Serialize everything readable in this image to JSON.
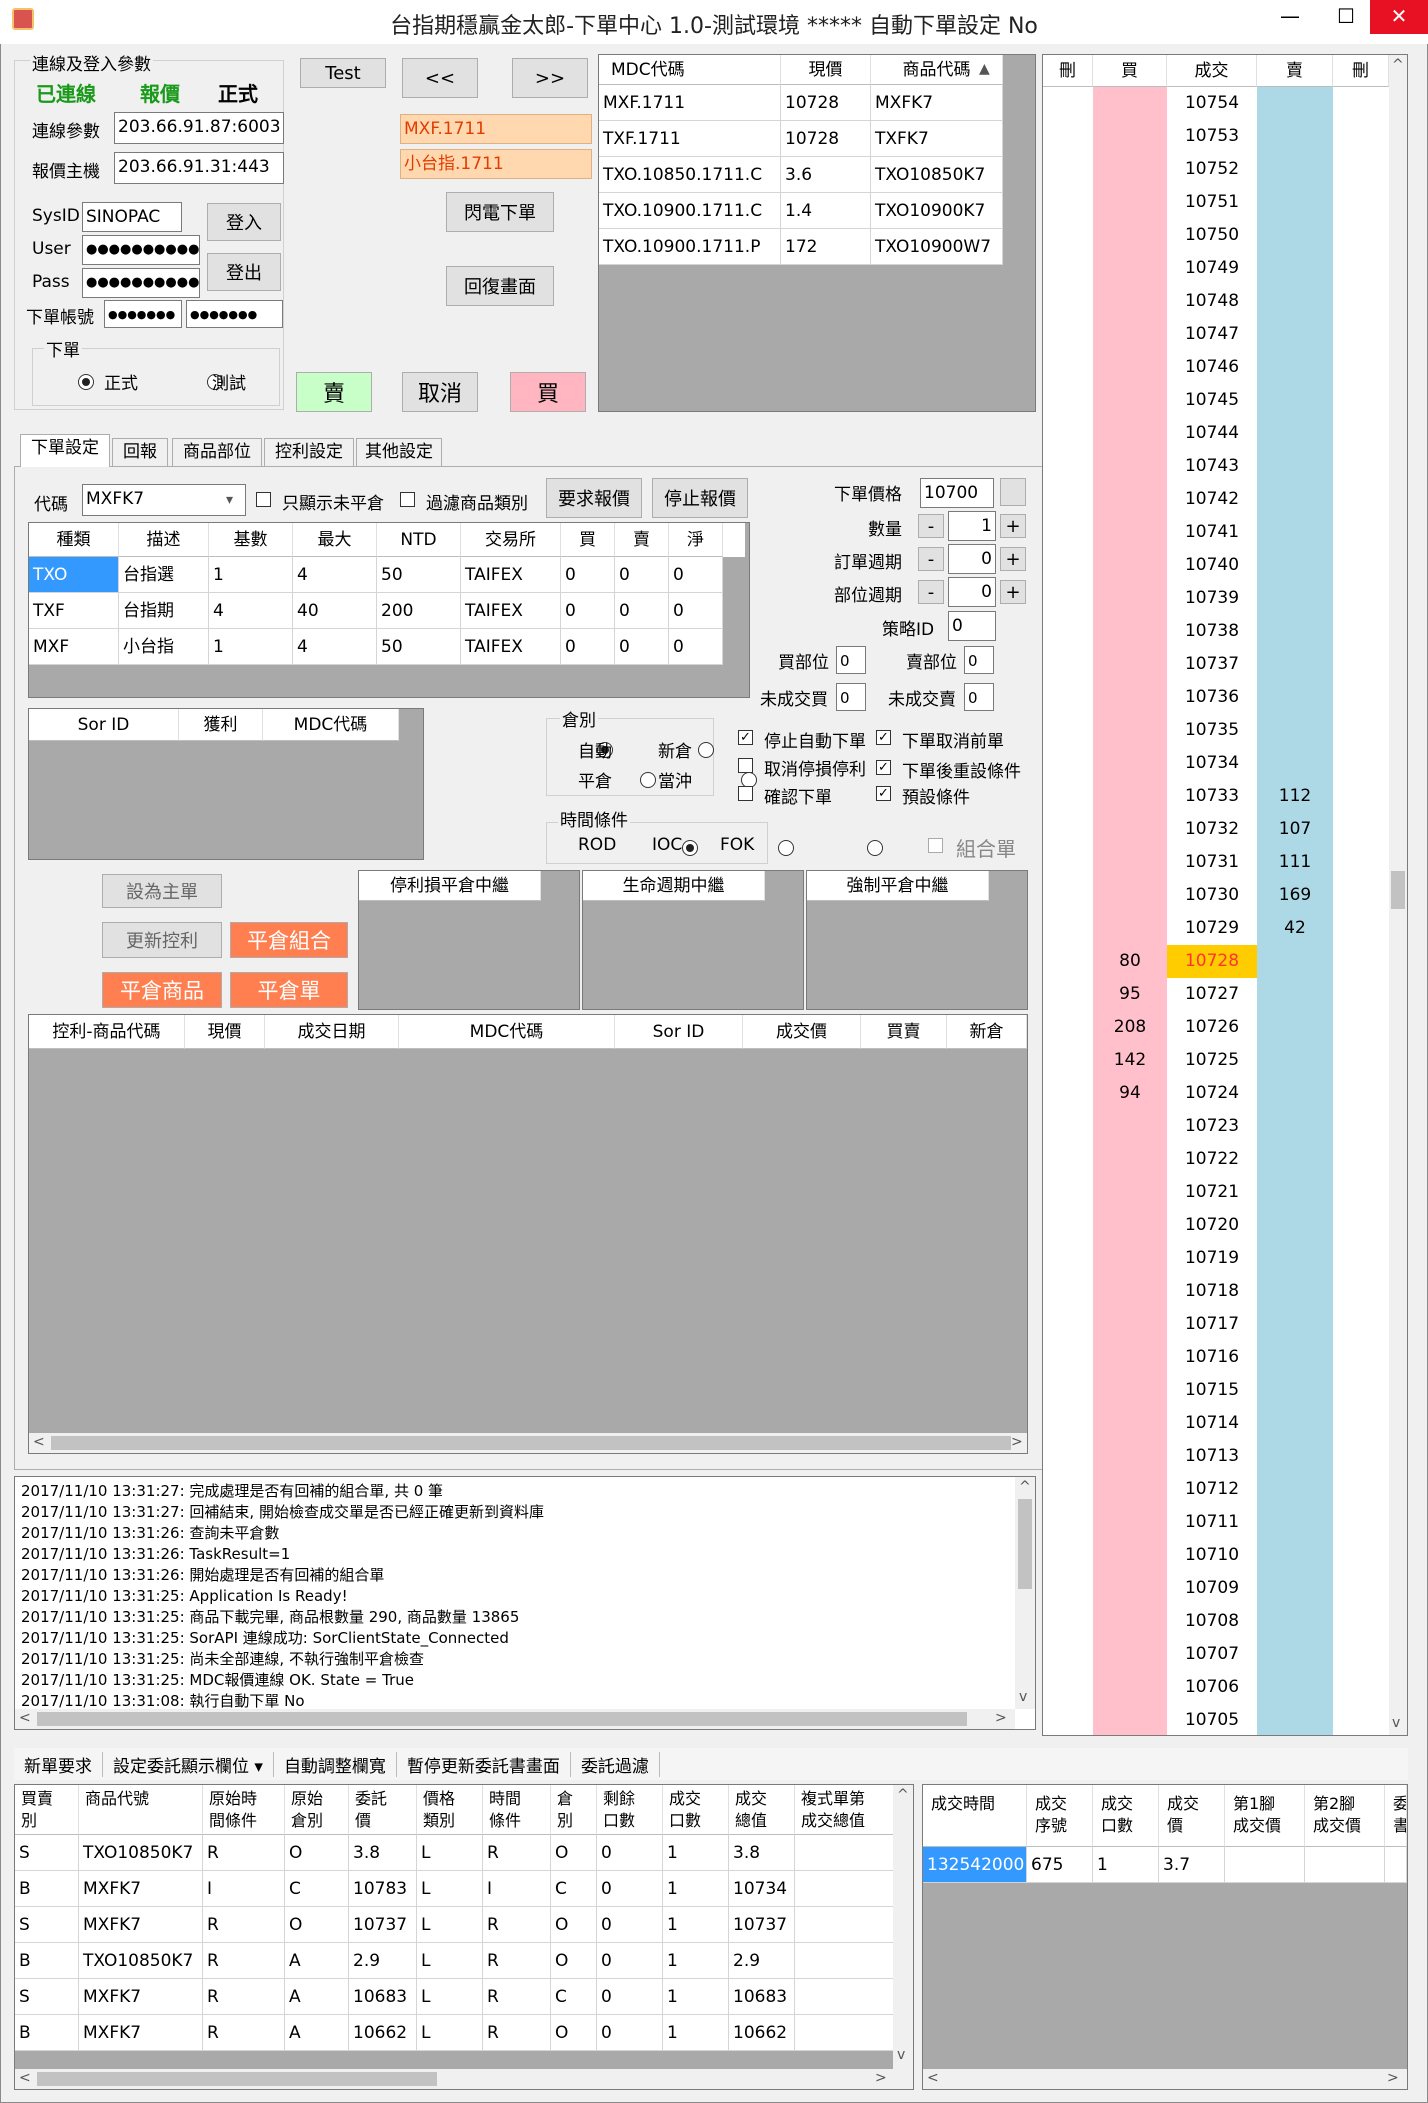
{
  "window": {
    "title": "台指期穩贏金太郎-下單中心 1.0-測試環境 ***** 自動下單設定 No",
    "minimize": "—",
    "maximize": "☐",
    "close": "✕"
  },
  "login": {
    "group": "連線及登入參數",
    "status_connected": "已連線",
    "status_quote": "報價",
    "status_mode": "正式",
    "conn_label": "連線參數",
    "conn_value": "203.66.91.87:6003",
    "quote_label": "報價主機",
    "quote_value": "203.66.91.31:443",
    "sysid_label": "SysID",
    "sysid_value": "SINOPAC",
    "user_label": "User",
    "user_value": "●●●●●●●●●●●",
    "pass_label": "Pass",
    "pass_value": "●●●●●●●●●●●",
    "account_label": "下單帳號",
    "account_value1": "●●●●●●●",
    "account_value2": "●●●●●●●",
    "login_btn": "登入",
    "logout_btn": "登出",
    "order_group": "下單",
    "radio_real": "正式",
    "radio_test": "測試"
  },
  "center": {
    "test_btn": "Test",
    "prev_btn": "<<",
    "next_btn": ">>",
    "sym1": "MXF.1711",
    "sym2": "小台指.1711",
    "flash_btn": "閃電下單",
    "restore_btn": "回復畫面",
    "sell_btn": "賣",
    "cancel_btn": "取消",
    "buy_btn": "買"
  },
  "mdc": {
    "headers": [
      "MDC代碼",
      "現價",
      "商品代碼"
    ],
    "rows": [
      [
        "MXF.1711",
        "10728",
        "MXFK7"
      ],
      [
        "TXF.1711",
        "10728",
        "TXFK7"
      ],
      [
        "TXO.10850.1711.C",
        "3.6",
        "TXO10850K7"
      ],
      [
        "TXO.10900.1711.C",
        "1.4",
        "TXO10900K7"
      ],
      [
        "TXO.10900.1711.P",
        "172",
        "TXO10900W7"
      ]
    ]
  },
  "tabs": [
    "下單設定",
    "回報",
    "商品部位",
    "控利設定",
    "其他設定"
  ],
  "order": {
    "code_label": "代碼",
    "code_value": "MXFK7",
    "only_open_label": "只顯示未平倉",
    "filter_label": "過濾商品類別",
    "req_quote_btn": "要求報價",
    "stop_quote_btn": "停止報價",
    "price_label": "下單價格",
    "price_value": "10700",
    "qty_label": "數量",
    "qty_value": "1",
    "order_cycle_label": "訂單週期",
    "order_cycle_value": "0",
    "pos_cycle_label": "部位週期",
    "pos_cycle_value": "0",
    "strategy_label": "策略ID",
    "strategy_value": "0",
    "buy_pos_label": "買部位",
    "buy_pos_value": "0",
    "sell_pos_label": "賣部位",
    "sell_pos_value": "0",
    "unfilled_buy_label": "未成交買",
    "unfilled_buy_value": "0",
    "unfilled_sell_label": "未成交賣",
    "unfilled_sell_value": "0",
    "minus": "-",
    "plus": "+"
  },
  "products": {
    "headers": [
      "種類",
      "描述",
      "基數",
      "最大",
      "NTD",
      "交易所",
      "買",
      "賣",
      "淨"
    ],
    "rows": [
      [
        "TXO",
        "台指選",
        "1",
        "4",
        "50",
        "TAIFEX",
        "0",
        "0",
        "0"
      ],
      [
        "TXF",
        "台指期",
        "4",
        "40",
        "200",
        "TAIFEX",
        "0",
        "0",
        "0"
      ],
      [
        "MXF",
        "小台指",
        "1",
        "4",
        "50",
        "TAIFEX",
        "0",
        "0",
        "0"
      ]
    ]
  },
  "sor": {
    "headers": [
      "Sor ID",
      "獲利",
      "MDC代碼"
    ]
  },
  "position": {
    "group": "倉別",
    "auto": "自動",
    "new": "新倉",
    "close": "平倉",
    "daytrade": "當沖",
    "time_group": "時間條件",
    "rod": "ROD",
    "ioc": "IOC",
    "fok": "FOK"
  },
  "checks": {
    "stop_auto": "停止自動下單",
    "cancel_before": "下單取消前單",
    "cancel_stop": "取消停損停利",
    "reset_after": "下單後重設條件",
    "confirm": "確認下單",
    "preset": "預設條件",
    "combo": "組合單"
  },
  "actions": {
    "set_main": "設為主單",
    "update_ctrl": "更新控利",
    "close_combo": "平倉組合",
    "close_product": "平倉商品",
    "close_order": "平倉單",
    "relay1": "停利損平倉中繼",
    "relay2": "生命週期中繼",
    "relay3": "強制平倉中繼"
  },
  "ctrl_grid": {
    "headers": [
      "控利-商品代碼",
      "現價",
      "成交日期",
      "MDC代碼",
      "Sor ID",
      "成交價",
      "買賣",
      "新倉"
    ]
  },
  "log": [
    "2017/11/10 13:31:27: 完成處理是否有回補的組合單, 共 0 筆",
    "2017/11/10 13:31:27: 回補結束, 開始檢查成交單是否已經正確更新到資料庫",
    "2017/11/10 13:31:26: 查詢未平倉數",
    "2017/11/10 13:31:26: TaskResult=1",
    "2017/11/10 13:31:26: 開始處理是否有回補的組合單",
    "2017/11/10 13:31:25: Application Is Ready!",
    "2017/11/10 13:31:25: 商品下載完畢, 商品根數量 290, 商品數量 13865",
    "2017/11/10 13:31:25: SorAPI 連線成功: SorClientState_Connected",
    "2017/11/10 13:31:25: 尚未全部連線, 不執行強制平倉檢查",
    "2017/11/10 13:31:25: MDC報價連線 OK. State = True",
    "2017/11/10 13:31:08: 執行自動下單 No"
  ],
  "ladder": {
    "headers": [
      "刪",
      "買",
      "成交",
      "賣",
      "刪"
    ],
    "rows": [
      [
        "",
        "",
        "10754",
        "",
        ""
      ],
      [
        "",
        "",
        "10753",
        "",
        ""
      ],
      [
        "",
        "",
        "10752",
        "",
        ""
      ],
      [
        "",
        "",
        "10751",
        "",
        ""
      ],
      [
        "",
        "",
        "10750",
        "",
        ""
      ],
      [
        "",
        "",
        "10749",
        "",
        ""
      ],
      [
        "",
        "",
        "10748",
        "",
        ""
      ],
      [
        "",
        "",
        "10747",
        "",
        ""
      ],
      [
        "",
        "",
        "10746",
        "",
        ""
      ],
      [
        "",
        "",
        "10745",
        "",
        ""
      ],
      [
        "",
        "",
        "10744",
        "",
        ""
      ],
      [
        "",
        "",
        "10743",
        "",
        ""
      ],
      [
        "",
        "",
        "10742",
        "",
        ""
      ],
      [
        "",
        "",
        "10741",
        "",
        ""
      ],
      [
        "",
        "",
        "10740",
        "",
        ""
      ],
      [
        "",
        "",
        "10739",
        "",
        ""
      ],
      [
        "",
        "",
        "10738",
        "",
        ""
      ],
      [
        "",
        "",
        "10737",
        "",
        ""
      ],
      [
        "",
        "",
        "10736",
        "",
        ""
      ],
      [
        "",
        "",
        "10735",
        "",
        ""
      ],
      [
        "",
        "",
        "10734",
        "",
        ""
      ],
      [
        "",
        "",
        "10733",
        "112",
        ""
      ],
      [
        "",
        "",
        "10732",
        "107",
        ""
      ],
      [
        "",
        "",
        "10731",
        "111",
        ""
      ],
      [
        "",
        "",
        "10730",
        "169",
        ""
      ],
      [
        "",
        "",
        "10729",
        "42",
        ""
      ],
      [
        "",
        "80",
        "10728",
        "",
        ""
      ],
      [
        "",
        "95",
        "10727",
        "",
        ""
      ],
      [
        "",
        "208",
        "10726",
        "",
        ""
      ],
      [
        "",
        "142",
        "10725",
        "",
        ""
      ],
      [
        "",
        "94",
        "10724",
        "",
        ""
      ],
      [
        "",
        "",
        "10723",
        "",
        ""
      ],
      [
        "",
        "",
        "10722",
        "",
        ""
      ],
      [
        "",
        "",
        "10721",
        "",
        ""
      ],
      [
        "",
        "",
        "10720",
        "",
        ""
      ],
      [
        "",
        "",
        "10719",
        "",
        ""
      ],
      [
        "",
        "",
        "10718",
        "",
        ""
      ],
      [
        "",
        "",
        "10717",
        "",
        ""
      ],
      [
        "",
        "",
        "10716",
        "",
        ""
      ],
      [
        "",
        "",
        "10715",
        "",
        ""
      ],
      [
        "",
        "",
        "10714",
        "",
        ""
      ],
      [
        "",
        "",
        "10713",
        "",
        ""
      ],
      [
        "",
        "",
        "10712",
        "",
        ""
      ],
      [
        "",
        "",
        "10711",
        "",
        ""
      ],
      [
        "",
        "",
        "10710",
        "",
        ""
      ],
      [
        "",
        "",
        "10709",
        "",
        ""
      ],
      [
        "",
        "",
        "10708",
        "",
        ""
      ],
      [
        "",
        "",
        "10707",
        "",
        ""
      ],
      [
        "",
        "",
        "10706",
        "",
        ""
      ],
      [
        "",
        "",
        "10705",
        "",
        ""
      ]
    ],
    "current": "10728"
  },
  "toolbar": [
    "新單要求",
    "設定委託顯示欄位 ▾",
    "自動調整欄寬",
    "暫停更新委託書畫面",
    "委託過濾"
  ],
  "orders": {
    "headers": [
      "買賣\n別",
      "商品代號",
      "原始時\n間條件",
      "原始\n倉別",
      "委託\n價",
      "價格\n類別",
      "時間\n條件",
      "倉\n別",
      "剩餘\n口數",
      "成交\n口數",
      "成交\n總值",
      "複式單第\n成交總值"
    ],
    "rows": [
      [
        "S",
        "TXO10850K7",
        "R",
        "O",
        "3.8",
        "L",
        "R",
        "O",
        "0",
        "1",
        "3.8",
        ""
      ],
      [
        "B",
        "MXFK7",
        "I",
        "C",
        "10783",
        "L",
        "I",
        "C",
        "0",
        "1",
        "10734",
        ""
      ],
      [
        "S",
        "MXFK7",
        "R",
        "O",
        "10737",
        "L",
        "R",
        "O",
        "0",
        "1",
        "10737",
        ""
      ],
      [
        "B",
        "TXO10850K7",
        "R",
        "A",
        "2.9",
        "L",
        "R",
        "O",
        "0",
        "1",
        "2.9",
        ""
      ],
      [
        "S",
        "MXFK7",
        "R",
        "A",
        "10683",
        "L",
        "R",
        "C",
        "0",
        "1",
        "10683",
        ""
      ],
      [
        "B",
        "MXFK7",
        "R",
        "A",
        "10662",
        "L",
        "R",
        "O",
        "0",
        "1",
        "10662",
        ""
      ]
    ]
  },
  "fills": {
    "headers": [
      "成交時間",
      "成交\n序號",
      "成交\n口數",
      "成交\n價",
      "第1腳\n成交價",
      "第2腳\n成交價",
      "委\n書"
    ],
    "rows": [
      [
        "132542000",
        "675",
        "1",
        "3.7",
        "",
        "",
        ""
      ]
    ]
  },
  "colors": {
    "buy_col": "#ffc0cb",
    "sell_col": "#add8e6",
    "current": "#ffcc00",
    "current_text": "#ff3333",
    "orange": "#ff7f50",
    "green_btn": "#c8ffc8",
    "pink_btn": "#ffb6c1"
  }
}
